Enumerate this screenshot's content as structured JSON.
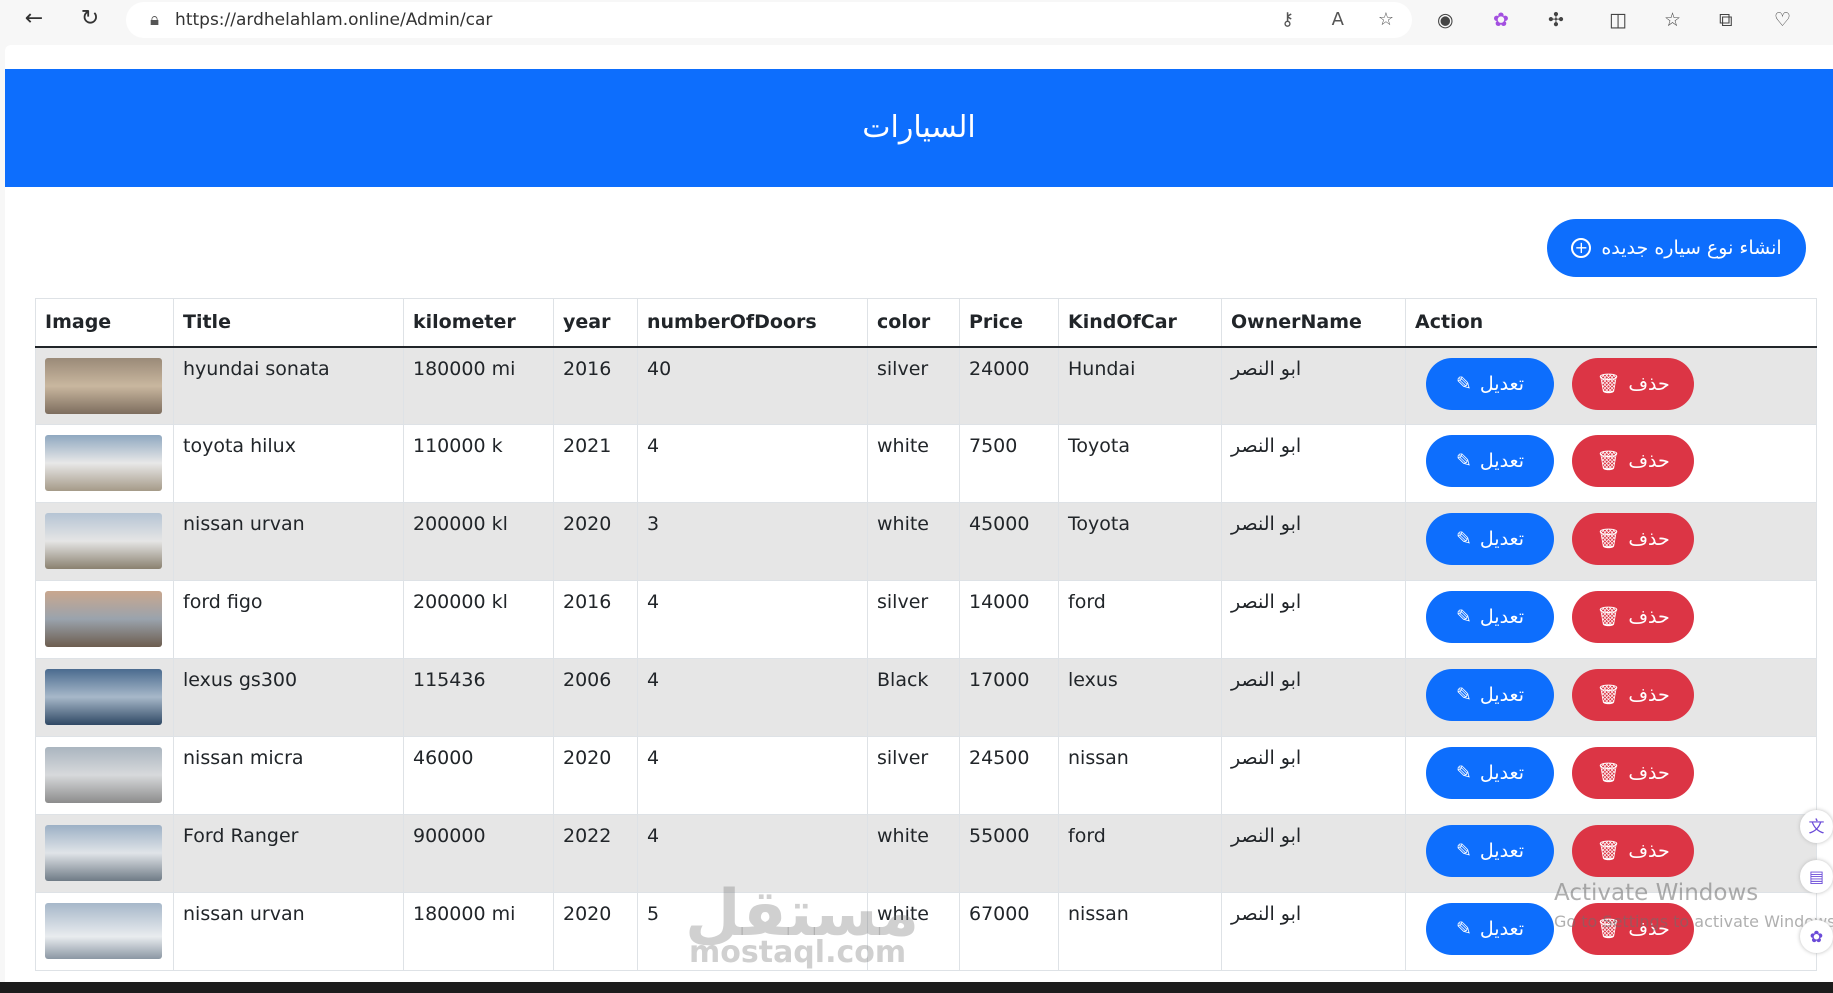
{
  "browser": {
    "url": "https://ardhelahlam.online/Admin/car"
  },
  "header": {
    "title": "السيارات"
  },
  "create_button": "انشاء نوع سياره جديده",
  "table": {
    "headers": [
      "Image",
      "Title",
      "kilometer",
      "year",
      "numberOfDoors",
      "color",
      "Price",
      "KindOfCar",
      "OwnerName",
      "Action"
    ],
    "rows": [
      {
        "title": "hyundai sonata",
        "km": "180000 mi",
        "year": "2016",
        "doors": "40",
        "color": "silver",
        "price": "24000",
        "kind": "Hundai",
        "owner": "ابو النصر"
      },
      {
        "title": "toyota hilux",
        "km": "110000 k",
        "year": "2021",
        "doors": "4",
        "color": "white",
        "price": "7500",
        "kind": "Toyota",
        "owner": "ابو النصر"
      },
      {
        "title": "nissan urvan",
        "km": "200000 kl",
        "year": "2020",
        "doors": "3",
        "color": "white",
        "price": "45000",
        "kind": "Toyota",
        "owner": "ابو النصر"
      },
      {
        "title": "ford figo",
        "km": "200000 kl",
        "year": "2016",
        "doors": "4",
        "color": "silver",
        "price": "14000",
        "kind": "ford",
        "owner": "ابو النصر"
      },
      {
        "title": "lexus gs300",
        "km": "115436",
        "year": "2006",
        "doors": "4",
        "color": "Black",
        "price": "17000",
        "kind": "lexus",
        "owner": "ابو النصر"
      },
      {
        "title": "nissan micra",
        "km": "46000",
        "year": "2020",
        "doors": "4",
        "color": "silver",
        "price": "24500",
        "kind": "nissan",
        "owner": "ابو النصر"
      },
      {
        "title": "Ford Ranger",
        "km": "900000",
        "year": "2022",
        "doors": "4",
        "color": "white",
        "price": "55000",
        "kind": "ford",
        "owner": "ابو النصر"
      },
      {
        "title": "nissan urvan",
        "km": "180000 mi",
        "year": "2020",
        "doors": "5",
        "color": "white",
        "price": "67000",
        "kind": "nissan",
        "owner": "ابو النصر"
      }
    ],
    "edit_label": "تعديل",
    "delete_label": "حذف"
  },
  "watermark": {
    "brand": "mostaql.com",
    "activate_title": "Activate Windows",
    "activate_sub": "Go to Settings to activate Windows."
  },
  "colors": {
    "primary": "#0d6efd",
    "danger": "#dc3545"
  }
}
